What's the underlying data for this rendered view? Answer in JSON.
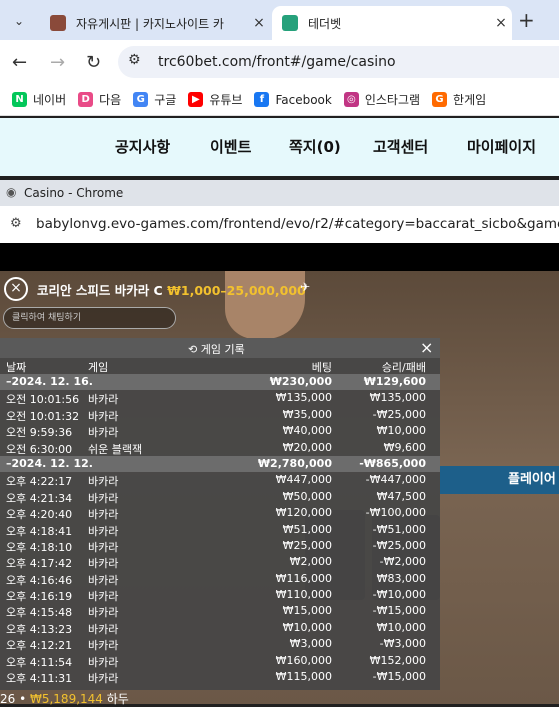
{
  "browser": {
    "tabs": [
      {
        "title": "자유게시판 | 카지노사이트 카",
        "close": "×"
      },
      {
        "title": "테더벳",
        "close": "×"
      }
    ],
    "new_tab": "+",
    "url": "trc60bet.com/front#/game/casino",
    "bookmarks": [
      {
        "label": "네이버",
        "icon": "N",
        "color": "#03c75a"
      },
      {
        "label": "다음",
        "icon": "D",
        "color": "#e94b87"
      },
      {
        "label": "구글",
        "icon": "G",
        "color": "#4285f4"
      },
      {
        "label": "유튜브",
        "icon": "▶",
        "color": "#ff0000"
      },
      {
        "label": "Facebook",
        "icon": "f",
        "color": "#1877f2"
      },
      {
        "label": "인스타그램",
        "icon": "◎",
        "color": "#c13584"
      },
      {
        "label": "한게임",
        "icon": "G",
        "color": "#ff6a00"
      }
    ]
  },
  "site_nav": [
    "공지사항",
    "이벤트",
    "쪽지(0)",
    "고객센터",
    "마이페이지"
  ],
  "popup": {
    "title": "Casino - Chrome",
    "url": "babylonvg.evo-games.com/frontend/evo/r2/#category=baccarat_sicbo&game=bac"
  },
  "game": {
    "close": "×",
    "title": "코리안 스피드 바카라 C",
    "limit": "₩1,000–25,000,000",
    "chat_placeholder": "클릭하여 채팅하기",
    "player_banner": "플레이어",
    "bottom_text": "26 • ",
    "bottom_value": "₩5,189,144",
    "bottom_suffix": " 하두"
  },
  "history": {
    "title": "게임 기록",
    "close": "×",
    "columns": [
      "날짜",
      "게임",
      "베팅",
      "승리/패배"
    ],
    "rows": [
      {
        "date": true,
        "c1": "–2024. 12. 16.",
        "c3": "₩230,000",
        "c4": "₩129,600"
      },
      {
        "c1": "오전 10:01:56",
        "c2": "바카라",
        "c3": "₩135,000",
        "c4": "₩135,000"
      },
      {
        "c1": "오전 10:01:32",
        "c2": "바카라",
        "c3": "₩35,000",
        "c4": "-₩25,000"
      },
      {
        "c1": "오전 9:59:36",
        "c2": "바카라",
        "c3": "₩40,000",
        "c4": "₩10,000"
      },
      {
        "c1": "오전 6:30:00",
        "c2": "쉬운 블랙잭",
        "c3": "₩20,000",
        "c4": "₩9,600"
      },
      {
        "date": true,
        "c1": "–2024. 12. 12.",
        "c3": "₩2,780,000",
        "c4": "-₩865,000"
      },
      {
        "c1": "오후 4:22:17",
        "c2": "바카라",
        "c3": "₩447,000",
        "c4": "-₩447,000"
      },
      {
        "c1": "오후 4:21:34",
        "c2": "바카라",
        "c3": "₩50,000",
        "c4": "₩47,500"
      },
      {
        "c1": "오후 4:20:40",
        "c2": "바카라",
        "c3": "₩120,000",
        "c4": "-₩100,000"
      },
      {
        "c1": "오후 4:18:41",
        "c2": "바카라",
        "c3": "₩51,000",
        "c4": "-₩51,000"
      },
      {
        "c1": "오후 4:18:10",
        "c2": "바카라",
        "c3": "₩25,000",
        "c4": "-₩25,000"
      },
      {
        "c1": "오후 4:17:42",
        "c2": "바카라",
        "c3": "₩2,000",
        "c4": "-₩2,000"
      },
      {
        "c1": "오후 4:16:46",
        "c2": "바카라",
        "c3": "₩116,000",
        "c4": "₩83,000"
      },
      {
        "c1": "오후 4:16:19",
        "c2": "바카라",
        "c3": "₩110,000",
        "c4": "-₩10,000"
      },
      {
        "c1": "오후 4:15:48",
        "c2": "바카라",
        "c3": "₩15,000",
        "c4": "-₩15,000"
      },
      {
        "c1": "오후 4:13:23",
        "c2": "바카라",
        "c3": "₩10,000",
        "c4": "₩10,000"
      },
      {
        "c1": "오후 4:12:21",
        "c2": "바카라",
        "c3": "₩3,000",
        "c4": "-₩3,000"
      },
      {
        "c1": "오후 4:11:54",
        "c2": "바카라",
        "c3": "₩160,000",
        "c4": "₩152,000"
      },
      {
        "c1": "오후 4:11:31",
        "c2": "바카라",
        "c3": "₩115,000",
        "c4": "-₩15,000"
      }
    ]
  }
}
